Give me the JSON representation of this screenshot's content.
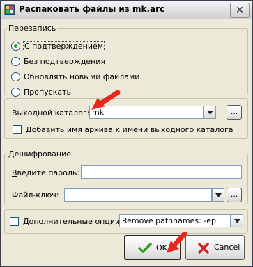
{
  "window": {
    "title": "Распаковать файлы из mk.arc",
    "close_glyph": "✕"
  },
  "overwrite": {
    "legend": "Перезапись",
    "options": [
      {
        "label": "С подтверждением",
        "selected": true
      },
      {
        "label": "Без подтверждения",
        "selected": false
      },
      {
        "label": "Обновлять новыми файлами",
        "selected": false
      },
      {
        "label": "Пропускать",
        "selected": false
      }
    ]
  },
  "output": {
    "label": "Выходной каталог:",
    "value": "mk",
    "browse_label": "...",
    "add_archive_name_label": "Добавить имя архива к имени выходного каталога",
    "add_archive_name_checked": false
  },
  "decryption": {
    "legend": "Дешифрование",
    "password_label": "Введите пароль:",
    "password_value": "",
    "keyfile_label": "Файл-ключ:",
    "keyfile_value": "",
    "browse_label": "..."
  },
  "extra": {
    "label": "Дополнительные опции:",
    "checked": false,
    "value": "Remove pathnames: -ep"
  },
  "buttons": {
    "ok": "OK",
    "cancel": "Cancel"
  },
  "colors": {
    "accent_arrow": "#e8281c",
    "radio_dot": "#21a121",
    "ok_icon": "#3a9b2a",
    "cancel_icon": "#d22020"
  }
}
